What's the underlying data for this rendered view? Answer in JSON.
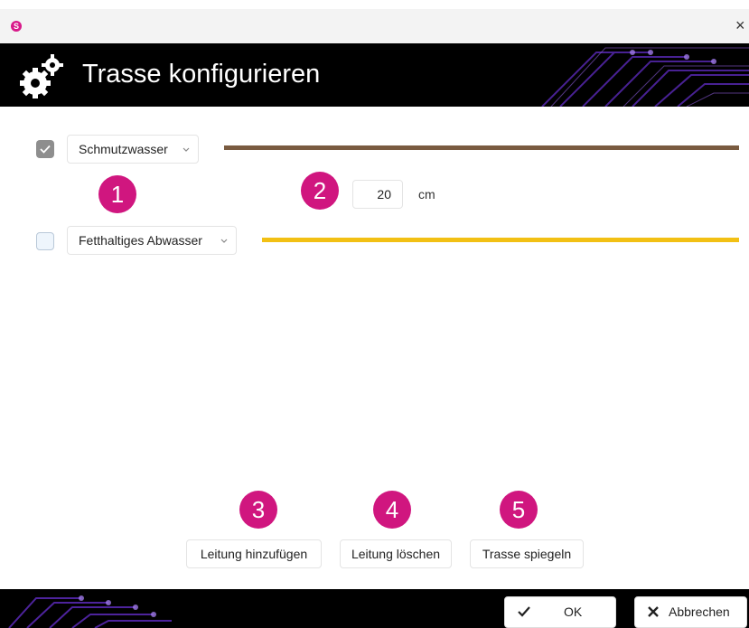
{
  "window": {
    "app_icon_letter": "S",
    "close_glyph": "×",
    "title": "Trasse konfigurieren"
  },
  "rows": [
    {
      "checked": true,
      "type": "Schmutzwasser",
      "line_color": "#7a5b40"
    },
    {
      "checked": false,
      "type": "Fetthaltiges Abwasser",
      "line_color": "#f2c014"
    }
  ],
  "spacing": {
    "value": "20",
    "unit": "cm"
  },
  "badges": [
    "1",
    "2",
    "3",
    "4",
    "5"
  ],
  "actions": {
    "add": "Leitung hinzufügen",
    "delete": "Leitung löschen",
    "mirror": "Trasse spiegeln"
  },
  "footer": {
    "ok": "OK",
    "cancel": "Abbrechen"
  },
  "colors": {
    "badge": "#d0167f",
    "accent_circuit": "#6a2cc9"
  },
  "icons": [
    "gear-icon",
    "checkmark-icon",
    "chevron-down-icon",
    "close-icon"
  ]
}
